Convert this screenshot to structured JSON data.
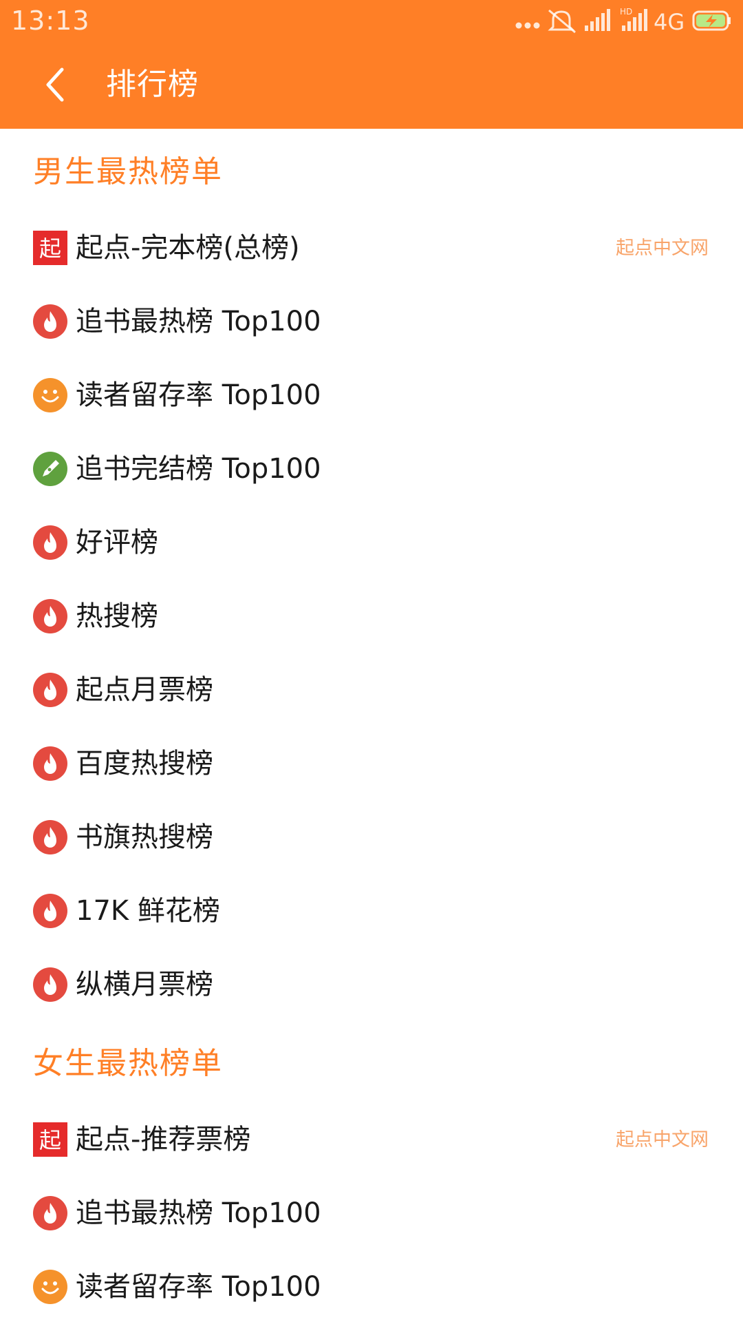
{
  "status_bar": {
    "time": "13:13",
    "network": "4G",
    "hd_badge": "HD",
    "icons": [
      "more-dots-icon",
      "mute-bell-icon",
      "signal-icon",
      "hd-signal-icon",
      "network-4g-icon",
      "battery-charging-icon"
    ]
  },
  "toolbar": {
    "back_icon": "chevron-left-icon",
    "title": "排行榜"
  },
  "colors": {
    "accent": "#FF7F26",
    "source_text": "#F8A46A",
    "flame": "#E44A3F",
    "smile": "#F5922B",
    "pen": "#5FA13E",
    "qidian": "#E52B2B"
  },
  "male_section": {
    "title": "男生最热榜单",
    "items": [
      {
        "icon": "qidian-logo-icon",
        "label": "起点-完本榜(总榜)",
        "source": "起点中文网"
      },
      {
        "icon": "flame-icon",
        "label": "追书最热榜 Top100"
      },
      {
        "icon": "smile-icon",
        "label": "读者留存率 Top100"
      },
      {
        "icon": "pen-icon",
        "label": "追书完结榜 Top100"
      },
      {
        "icon": "flame-icon",
        "label": "好评榜"
      },
      {
        "icon": "flame-icon",
        "label": "热搜榜"
      },
      {
        "icon": "flame-icon",
        "label": "起点月票榜"
      },
      {
        "icon": "flame-icon",
        "label": "百度热搜榜"
      },
      {
        "icon": "flame-icon",
        "label": "书旗热搜榜"
      },
      {
        "icon": "flame-icon",
        "label": "17K 鲜花榜"
      },
      {
        "icon": "flame-icon",
        "label": "纵横月票榜"
      }
    ]
  },
  "female_section": {
    "title": "女生最热榜单",
    "items": [
      {
        "icon": "qidian-logo-icon",
        "label": "起点-推荐票榜",
        "source": "起点中文网"
      },
      {
        "icon": "flame-icon",
        "label": "追书最热榜 Top100"
      },
      {
        "icon": "smile-icon",
        "label": "读者留存率 Top100"
      }
    ]
  },
  "qidian_logo_text": "起"
}
